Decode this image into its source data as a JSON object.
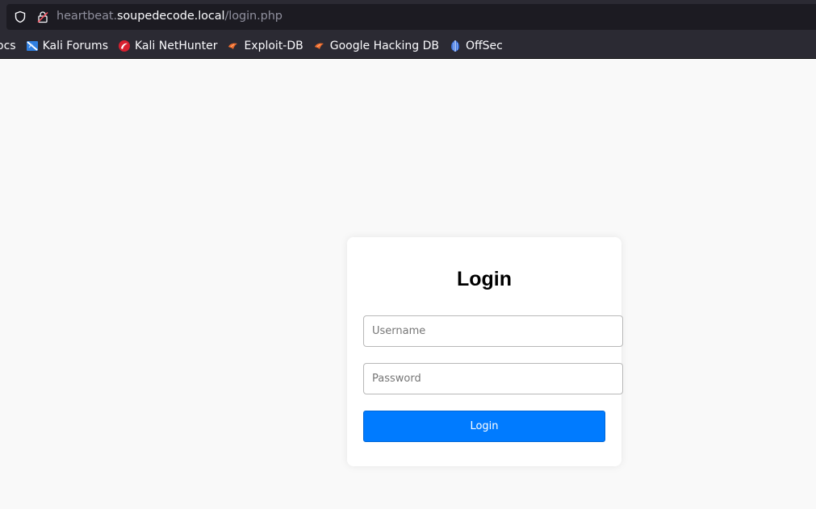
{
  "browser": {
    "url": {
      "prefix": "heartbeat.",
      "domain": "soupedecode.local",
      "path": "/login.php"
    },
    "bookmarks": [
      {
        "label": "ocs",
        "icon": "none"
      },
      {
        "label": "Kali Forums",
        "icon": "kali-forums-icon"
      },
      {
        "label": "Kali NetHunter",
        "icon": "kali-nethunter-icon"
      },
      {
        "label": "Exploit-DB",
        "icon": "exploit-db-icon"
      },
      {
        "label": "Google Hacking DB",
        "icon": "ghdb-icon"
      },
      {
        "label": "OffSec",
        "icon": "offsec-icon"
      }
    ]
  },
  "login": {
    "title": "Login",
    "username_placeholder": "Username",
    "password_placeholder": "Password",
    "submit_label": "Login"
  },
  "colors": {
    "primary_button": "#007bff",
    "page_background": "#f9f9f9",
    "chrome_background": "#2b2a33"
  }
}
